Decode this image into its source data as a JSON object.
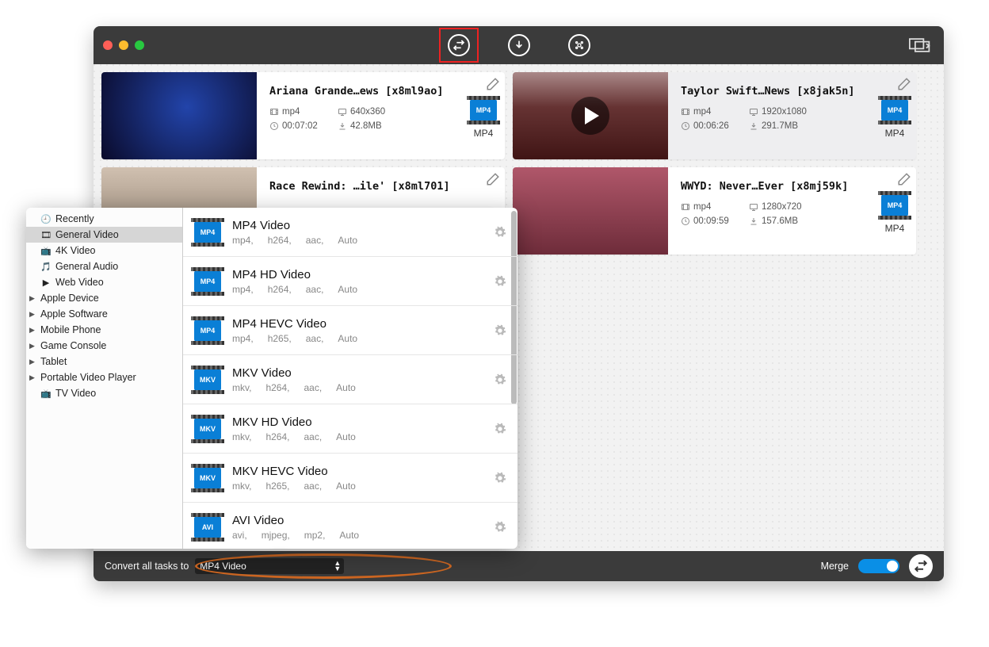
{
  "videos": [
    {
      "title": "Ariana Grande…ews [x8ml9ao]",
      "fmt": "mp4",
      "res": "640x360",
      "dur": "00:07:02",
      "size": "42.8MB",
      "out": "MP4",
      "thumb_class": "c1"
    },
    {
      "title": "Taylor Swift…News [x8jak5n]",
      "fmt": "mp4",
      "res": "1920x1080",
      "dur": "00:06:26",
      "size": "291.7MB",
      "out": "MP4",
      "thumb_class": "c2",
      "selected": true,
      "play": true
    },
    {
      "title": "Race Rewind: …ile' [x8ml701]",
      "fmt": "",
      "res": "",
      "dur": "",
      "size": "",
      "out": "",
      "thumb_class": "c3"
    },
    {
      "title": "WWYD:  Never…Ever [x8mj59k]",
      "fmt": "mp4",
      "res": "1280x720",
      "dur": "00:09:59",
      "size": "157.6MB",
      "out": "MP4",
      "thumb_class": "c4"
    }
  ],
  "sidebar": [
    {
      "label": "Recently",
      "icon": "🕘"
    },
    {
      "label": "General Video",
      "icon": "🎞",
      "selected": true
    },
    {
      "label": "4K Video",
      "icon": "📺"
    },
    {
      "label": "General Audio",
      "icon": "🎵"
    },
    {
      "label": "Web Video",
      "icon": "▶"
    },
    {
      "label": "Apple Device",
      "expandable": true
    },
    {
      "label": "Apple Software",
      "expandable": true
    },
    {
      "label": "Mobile Phone",
      "expandable": true
    },
    {
      "label": "Game Console",
      "expandable": true
    },
    {
      "label": "Tablet",
      "expandable": true
    },
    {
      "label": "Portable Video Player",
      "expandable": true
    },
    {
      "label": "TV Video",
      "icon": "📺"
    }
  ],
  "formats": [
    {
      "name": "MP4 Video",
      "tag": "MP4",
      "d": [
        "mp4,",
        "h264,",
        "aac,",
        "Auto"
      ]
    },
    {
      "name": "MP4 HD Video",
      "tag": "MP4",
      "d": [
        "mp4,",
        "h264,",
        "aac,",
        "Auto"
      ]
    },
    {
      "name": "MP4 HEVC Video",
      "tag": "MP4",
      "d": [
        "mp4,",
        "h265,",
        "aac,",
        "Auto"
      ]
    },
    {
      "name": "MKV Video",
      "tag": "MKV",
      "d": [
        "mkv,",
        "h264,",
        "aac,",
        "Auto"
      ]
    },
    {
      "name": "MKV HD Video",
      "tag": "MKV",
      "d": [
        "mkv,",
        "h264,",
        "aac,",
        "Auto"
      ]
    },
    {
      "name": "MKV HEVC Video",
      "tag": "MKV",
      "d": [
        "mkv,",
        "h265,",
        "aac,",
        "Auto"
      ]
    },
    {
      "name": "AVI Video",
      "tag": "AVI",
      "d": [
        "avi,",
        "mjpeg,",
        "mp2,",
        "Auto"
      ]
    }
  ],
  "bottombar": {
    "label": "Convert all tasks to",
    "selected": "MP4 Video",
    "merge_label": "Merge"
  }
}
